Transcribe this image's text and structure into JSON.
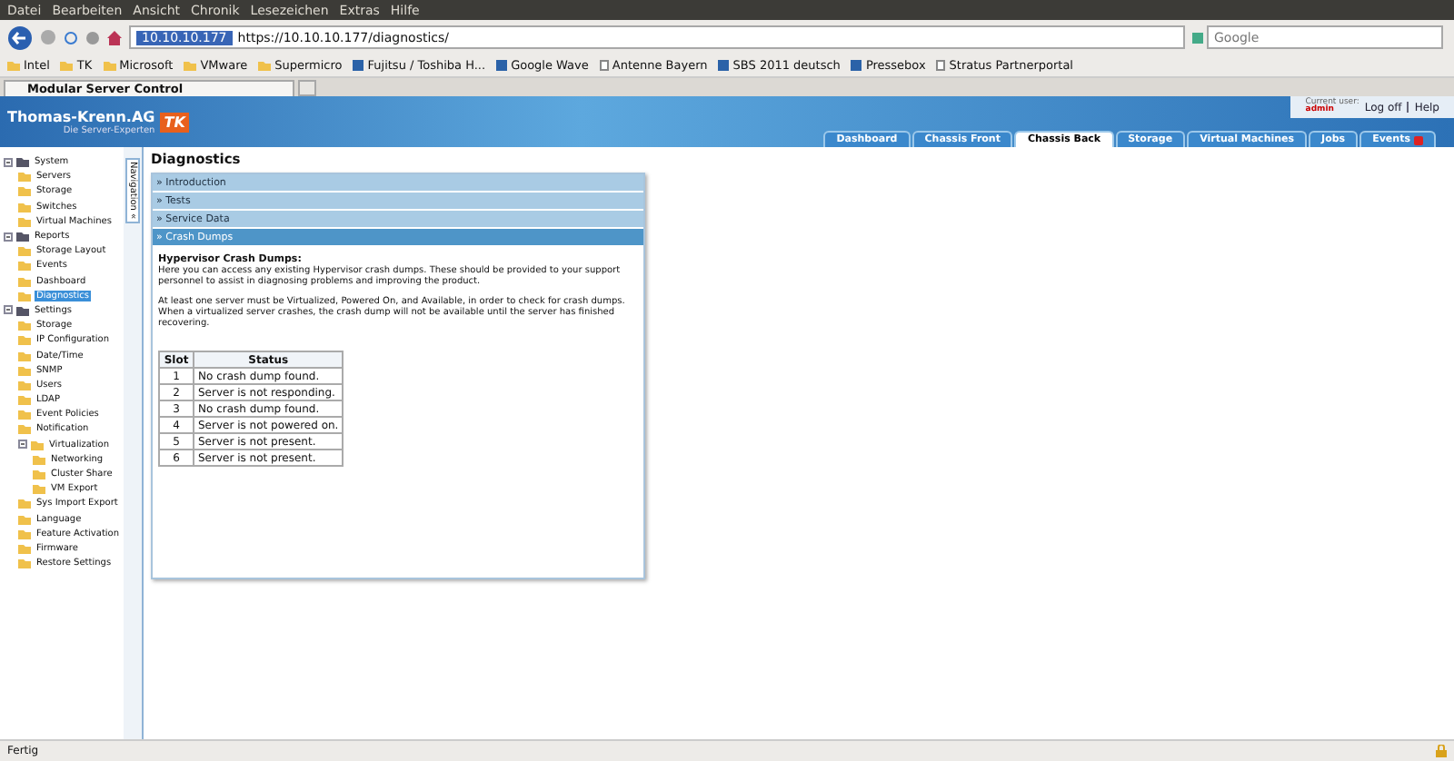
{
  "browser": {
    "menu": [
      "Datei",
      "Bearbeiten",
      "Ansicht",
      "Chronik",
      "Lesezeichen",
      "Extras",
      "Hilfe"
    ],
    "address": {
      "host": "10.10.10.177",
      "url": "https://10.10.10.177/diagnostics/"
    },
    "search": {
      "placeholder": "Google"
    },
    "bookmarks": [
      {
        "label": "Intel",
        "kind": "folder"
      },
      {
        "label": "TK",
        "kind": "folder"
      },
      {
        "label": "Microsoft",
        "kind": "folder"
      },
      {
        "label": "VMware",
        "kind": "folder"
      },
      {
        "label": "Supermicro",
        "kind": "folder"
      },
      {
        "label": "Fujitsu / Toshiba H...",
        "kind": "site"
      },
      {
        "label": "Google Wave",
        "kind": "site"
      },
      {
        "label": "Antenne Bayern",
        "kind": "page"
      },
      {
        "label": "SBS 2011 deutsch",
        "kind": "site"
      },
      {
        "label": "Pressebox",
        "kind": "site"
      },
      {
        "label": "Stratus Partnerportal",
        "kind": "page"
      }
    ],
    "tabs": [
      {
        "label": "Modular Server Control",
        "selected": true
      }
    ],
    "status": "Fertig"
  },
  "app": {
    "logo": {
      "name": "Thomas-Krenn.AG",
      "tagline": "Die Server-Experten",
      "badge": "TK"
    },
    "user": {
      "caption": "Current user:",
      "name": "admin",
      "logoff": "Log off",
      "help": "Help"
    },
    "tabs": [
      {
        "label": "Dashboard",
        "selected": false
      },
      {
        "label": "Chassis Front",
        "selected": false
      },
      {
        "label": "Chassis Back",
        "selected": true
      },
      {
        "label": "Storage",
        "selected": false
      },
      {
        "label": "Virtual Machines",
        "selected": false
      },
      {
        "label": "Jobs",
        "selected": false
      },
      {
        "label": "Events",
        "selected": false
      }
    ],
    "nav_tab": "Navigation «",
    "tree": [
      {
        "label": "System",
        "expanded": true,
        "selected": false,
        "children": [
          {
            "label": "Servers",
            "selected": false
          },
          {
            "label": "Storage",
            "selected": false
          },
          {
            "label": "Switches",
            "selected": false
          },
          {
            "label": "Virtual Machines",
            "selected": false
          }
        ]
      },
      {
        "label": "Reports",
        "expanded": true,
        "selected": false,
        "children": [
          {
            "label": "Storage Layout",
            "selected": false
          },
          {
            "label": "Events",
            "selected": false
          },
          {
            "label": "Dashboard",
            "selected": false
          },
          {
            "label": "Diagnostics",
            "selected": true
          }
        ]
      },
      {
        "label": "Settings",
        "expanded": true,
        "selected": false,
        "children": [
          {
            "label": "Storage",
            "selected": false
          },
          {
            "label": "IP Configuration",
            "selected": false
          },
          {
            "label": "Date/Time",
            "selected": false
          },
          {
            "label": "SNMP",
            "selected": false
          },
          {
            "label": "Users",
            "selected": false
          },
          {
            "label": "LDAP",
            "selected": false
          },
          {
            "label": "Event Policies",
            "selected": false
          },
          {
            "label": "Notification",
            "selected": false
          },
          {
            "label": "Virtualization",
            "expanded": true,
            "selected": false,
            "children": [
              {
                "label": "Networking",
                "selected": false
              },
              {
                "label": "Cluster Share",
                "selected": false
              },
              {
                "label": "VM Export",
                "selected": false
              }
            ]
          },
          {
            "label": "Sys Import Export",
            "selected": false
          },
          {
            "label": "Language",
            "selected": false
          },
          {
            "label": "Feature Activation",
            "selected": false
          },
          {
            "label": "Firmware",
            "selected": false
          },
          {
            "label": "Restore Settings",
            "selected": false
          }
        ]
      }
    ],
    "page_title": "Diagnostics",
    "sections": [
      {
        "label": "» Introduction",
        "expanded": false
      },
      {
        "label": "» Tests",
        "expanded": false
      },
      {
        "label": "» Service Data",
        "expanded": false
      },
      {
        "label": "» Crash Dumps",
        "expanded": true
      }
    ],
    "crash": {
      "heading": "Hypervisor Crash Dumps:",
      "intro": "Here you can access any existing Hypervisor crash dumps. These should be provided to your support personnel to assist in diagnosing problems and improving the product.",
      "note": "At least one server must be Virtualized, Powered On, and Available, in order to check for crash dumps. When a virtualized server crashes, the crash dump will not be available until the server has finished recovering.",
      "columns": [
        "Slot",
        "Status"
      ],
      "rows": [
        [
          "1",
          "No crash dump found."
        ],
        [
          "2",
          "Server is not responding."
        ],
        [
          "3",
          "No crash dump found."
        ],
        [
          "4",
          "Server is not powered on."
        ],
        [
          "5",
          "Server is not present."
        ],
        [
          "6",
          "Server is not present."
        ]
      ]
    }
  }
}
